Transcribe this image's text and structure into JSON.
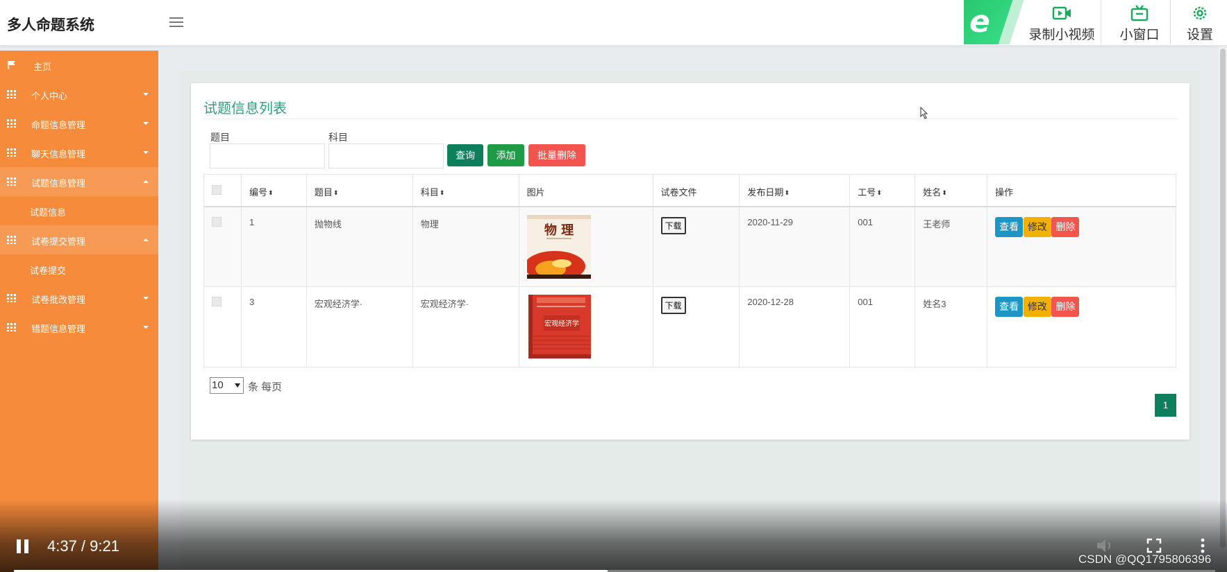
{
  "header": {
    "app_title": "多人命题系统",
    "toolbox": {
      "record_label": "录制小视频",
      "mini_window_label": "小窗口",
      "settings_label": "设置"
    }
  },
  "sidebar": {
    "items": [
      {
        "label": "主页",
        "icon": "flag-icon"
      },
      {
        "label": "个人中心",
        "icon": "grid-icon"
      },
      {
        "label": "命题信息管理",
        "icon": "grid-icon"
      },
      {
        "label": "聊天信息管理",
        "icon": "grid-icon"
      },
      {
        "label": "试题信息管理",
        "icon": "grid-icon",
        "sub": "试题信息"
      },
      {
        "label": "试卷提交管理",
        "icon": "grid-icon",
        "sub": "试卷提交"
      },
      {
        "label": "试卷批改管理",
        "icon": "grid-icon"
      },
      {
        "label": "错题信息管理",
        "icon": "grid-icon"
      }
    ]
  },
  "panel": {
    "title": "试题信息列表",
    "filters": {
      "subject_label": "题目",
      "course_label": "科目",
      "subject_value": "",
      "course_value": ""
    },
    "buttons": {
      "query": "查询",
      "add": "添加",
      "batch_delete": "批量删除"
    },
    "table": {
      "columns": [
        "编号",
        "题目",
        "科目",
        "图片",
        "试卷文件",
        "发布日期",
        "工号",
        "姓名",
        "操作"
      ],
      "rows": [
        {
          "id": "1",
          "title": "抛物线",
          "course": "物理",
          "image": "物理 textbook cover",
          "file_btn": "下载",
          "date": "2020-11-29",
          "staff_no": "001",
          "name": "王老师"
        },
        {
          "id": "3",
          "title": "宏观经济学·",
          "course": "宏观经济学·",
          "image": "宏观经济学 textbook cover",
          "file_btn": "下载",
          "date": "2020-12-28",
          "staff_no": "001",
          "name": "姓名3"
        }
      ],
      "actions": {
        "view": "查看",
        "edit": "修改",
        "delete": "删除"
      }
    },
    "pager": {
      "page_size": "10",
      "page_size_suffix": "条 每页",
      "current_page": "1"
    }
  },
  "video": {
    "time": "4:37 / 9:21",
    "progress": 0.494,
    "watermark": "CSDN @QQ1795806396"
  },
  "colors": {
    "sidebar": "#f68b3b",
    "accent_green": "#0d7f5c",
    "title_green": "#2aa177",
    "danger": "#f4544e",
    "info": "#1d96c6",
    "warning": "#f2b000"
  }
}
